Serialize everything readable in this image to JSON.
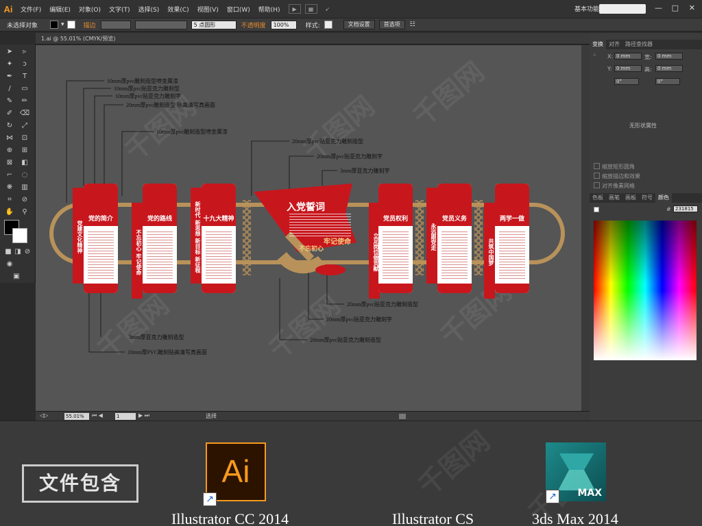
{
  "app": {
    "logo": "Ai",
    "menu": [
      "文件(F)",
      "编辑(E)",
      "对象(O)",
      "文字(T)",
      "选择(S)",
      "效果(C)",
      "视图(V)",
      "窗口(W)",
      "帮助(H)"
    ],
    "workspace": "基本功能",
    "window_controls": [
      "—",
      "□",
      "✕"
    ]
  },
  "control_bar": {
    "selection": "未选择对象",
    "stroke_label": "描边",
    "brush": "5 点圆形",
    "opacity_label": "不透明度",
    "opacity_value": "100%",
    "style_label": "样式:",
    "doc_setup": "文档设置",
    "preferences": "首选项"
  },
  "document": {
    "tab": "1.ai @ 55.01% (CMYK/预览)",
    "zoom": "55.01%",
    "page": "1",
    "status": "选择"
  },
  "right_panel": {
    "tabs_top": [
      "变换",
      "对齐",
      "路径查找器"
    ],
    "x_label": "X:",
    "y_label": "Y:",
    "w_label": "宽:",
    "h_label": "高:",
    "zero": "0 mm",
    "angle": "0°",
    "no_shape": "无形状属性",
    "checks": [
      "缩放矩形圆角",
      "缩放描边和效果",
      "对齐像素网格"
    ],
    "tabs_bottom": [
      "色板",
      "画笔",
      "画板",
      "符号",
      "颜色"
    ],
    "hex": "231815"
  },
  "artwork": {
    "oath_title": "入党誓词",
    "oath_slogan1": "牢记使命",
    "oath_slogan2": "不忘初心",
    "panels": [
      {
        "title": "党的简介",
        "side": "党建文化精神"
      },
      {
        "title": "党的路线",
        "side": "不忘初心 牢记使命"
      },
      {
        "title": "十九大精神",
        "side": "新时代 新思想 新目标 新征程"
      },
      {
        "title": "党员权利",
        "side": "立足岗位做贡献"
      },
      {
        "title": "党员义务",
        "side": "永远跟党走"
      },
      {
        "title": "两学一做",
        "side": "共筑中国梦"
      }
    ],
    "callouts_left": [
      "10mm厚pvc雕刻造型喷金属漆",
      "10mm厚pvc贴亚克力雕刻型",
      "10mm厚pvc贴亚克力雕刻字",
      "20mm厚pvc雕刻造型 贴高清写真画面",
      "10mm厚pvc雕刻造型喷金属漆"
    ],
    "callouts_center_top": [
      "20mm厚pvc贴亚克力雕刻造型",
      "20mm厚pvc贴亚克力雕刻字",
      "3mm厚亚克力雕刻字"
    ],
    "callouts_bottom_left": [
      "3mm厚亚克力雕刻造型",
      "10mm厚PVC雕刻贴高清写真画面"
    ],
    "callouts_bottom_right": [
      "20mm厚pvc贴亚克力雕刻造型",
      "10mm厚pvc贴亚克力雕刻字",
      "20mm厚pvc贴亚克力雕刻造型"
    ]
  },
  "bottom": {
    "file_contains": "文件包含",
    "ai_icon_text": "Ai",
    "max_icon_text": "MAX",
    "labels": [
      "Illustrator CC 2014",
      "Illustrator CS",
      "3ds Max 2014"
    ]
  },
  "colors": {
    "party_red": "#c8161d",
    "gold": "#b8925a",
    "canvas": "#555555"
  }
}
